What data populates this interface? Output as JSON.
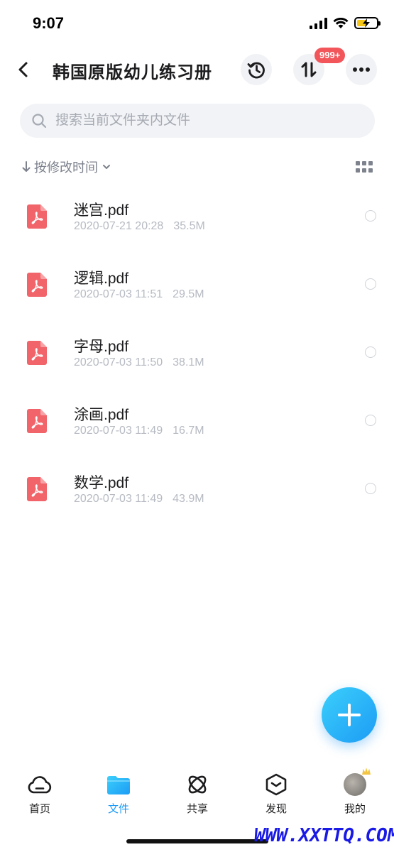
{
  "status_bar": {
    "time": "9:07"
  },
  "nav": {
    "title": "韩国原版幼儿练习册",
    "transfer_badge": "999+"
  },
  "search": {
    "placeholder": "搜索当前文件夹内文件"
  },
  "sort": {
    "label": "按修改时间"
  },
  "files": [
    {
      "name": "迷宫.pdf",
      "date": "2020-07-21 20:28",
      "size": "35.5M"
    },
    {
      "name": "逻辑.pdf",
      "date": "2020-07-03 11:51",
      "size": "29.5M"
    },
    {
      "name": "字母.pdf",
      "date": "2020-07-03 11:50",
      "size": "38.1M"
    },
    {
      "name": "涂画.pdf",
      "date": "2020-07-03 11:49",
      "size": "16.7M"
    },
    {
      "name": "数学.pdf",
      "date": "2020-07-03 11:49",
      "size": "43.9M"
    }
  ],
  "tabs": [
    {
      "label": "首页",
      "icon": "cloud-icon"
    },
    {
      "label": "文件",
      "icon": "folder-icon",
      "active": true
    },
    {
      "label": "共享",
      "icon": "share-orbit-icon"
    },
    {
      "label": "发现",
      "icon": "discover-cube-icon"
    },
    {
      "label": "我的",
      "icon": "avatar"
    }
  ],
  "watermark": "WWW.XXTTQ.COM",
  "colors": {
    "accent": "#1b9af7",
    "pdf": "#f0646a",
    "badge": "#f2555a"
  }
}
